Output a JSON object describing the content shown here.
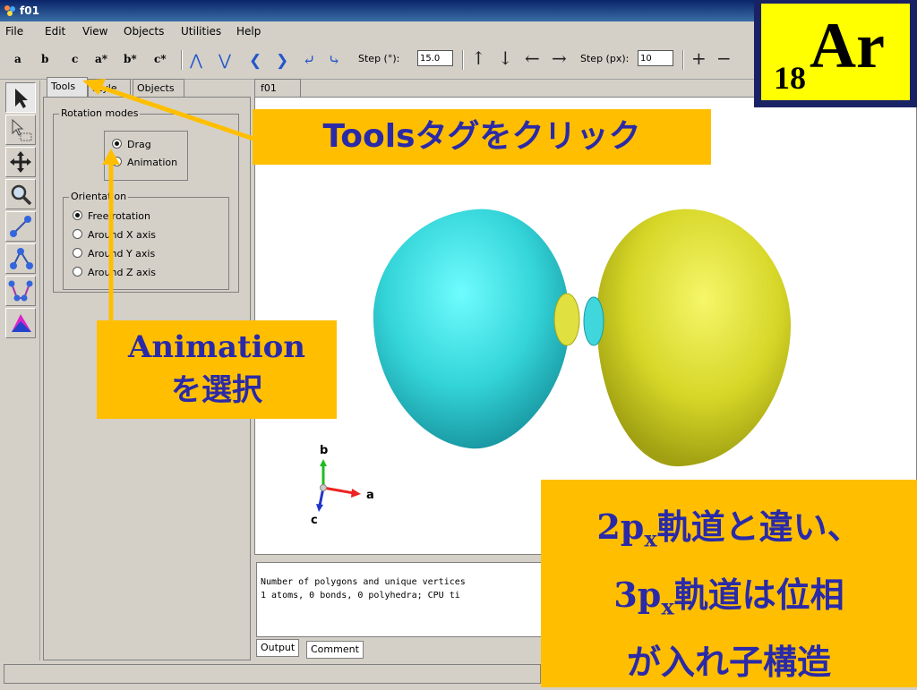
{
  "window": {
    "title": "f01"
  },
  "menu": [
    "File",
    "Edit",
    "View",
    "Objects",
    "Utilities",
    "Help"
  ],
  "toolbar": {
    "axis_buttons": [
      "a",
      "b",
      "c",
      "a*",
      "b*",
      "c*"
    ],
    "step_deg_label": "Step (°):",
    "step_deg_value": "15.0",
    "step_px_label": "Step (px):",
    "step_px_value": "10",
    "zoom_in": "+",
    "zoom_out": "−"
  },
  "side_panel": {
    "tabs": [
      "Tools",
      "Style",
      "Objects"
    ],
    "rotation_modes": {
      "title": "Rotation modes",
      "options": [
        "Drag",
        "Animation"
      ],
      "selected": "Drag"
    },
    "orientation": {
      "title": "Orientation",
      "options": [
        "Free rotation",
        "Around X axis",
        "Around Y axis",
        "Around Z axis"
      ],
      "selected": "Free rotation"
    }
  },
  "viewport": {
    "tab": "f01",
    "axes": {
      "a": "a",
      "b": "b",
      "c": "c"
    },
    "colors": {
      "left_lobe": "#3fd6dc",
      "right_lobe": "#d6d622"
    }
  },
  "output": {
    "lines": [
      "Number of polygons and unique vertices",
      "1 atoms, 0 bonds, 0 polyhedra; CPU ti"
    ],
    "tabs": [
      "Output",
      "Comment"
    ]
  },
  "annotations": {
    "tools_callout": "Toolsタグをクリック",
    "animation_callout_line1": "Animation",
    "animation_callout_line2": "を選択",
    "element_mass": "18",
    "element_symbol": "Ar",
    "note_line1_pre": "2p",
    "note_line1_sub": "x",
    "note_line1_post": "軌道と違い、",
    "note_line2_pre": "3p",
    "note_line2_sub": "x",
    "note_line2_post": "軌道は位相",
    "note_line3": "が入れ子構造"
  }
}
